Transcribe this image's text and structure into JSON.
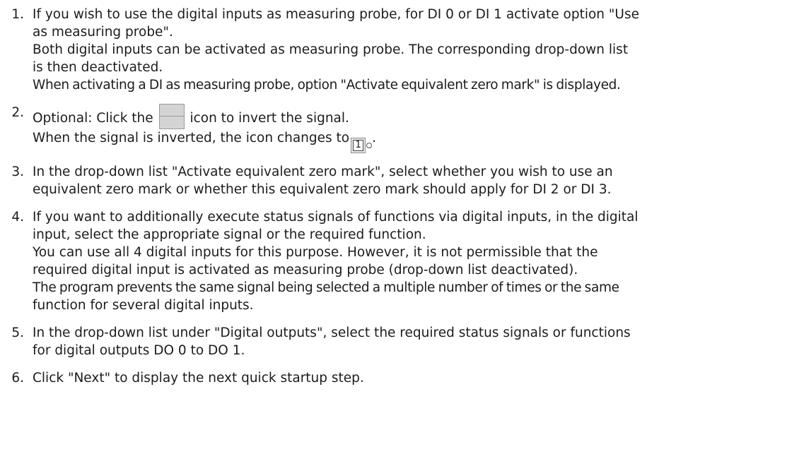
{
  "steps": [
    {
      "num": "1.",
      "lines": [
        "If you wish to use the digital inputs as measuring probe, for DI 0 or DI 1 activate option \"Use",
        "as measuring probe\".",
        "Both digital inputs can be activated as measuring probe. The corresponding drop-down list",
        "is then deactivated.",
        "When activating a DI as measuring probe, option \"Activate equivalent zero mark\" is displayed."
      ]
    },
    {
      "num": "2.",
      "line1_pre": "Optional: Click the",
      "line1_post": "icon to invert the signal.",
      "line2_pre": "When the signal is inverted, the icon changes to",
      "line2_post": ".",
      "icon_inverted_label": "1"
    },
    {
      "num": "3.",
      "lines": [
        "In the drop-down list \"Activate equivalent zero mark\", select whether you wish to use an",
        "equivalent zero mark or whether this equivalent zero mark should apply for DI 2 or DI 3."
      ]
    },
    {
      "num": "4.",
      "lines": [
        "If you want to additionally execute status signals of functions via digital inputs, in the digital",
        "input, select the appropriate signal or the required function.",
        "You can use all 4 digital inputs for this purpose. However, it is not permissible that the",
        "required digital input is activated as measuring probe (drop-down list deactivated).",
        "The program prevents the same signal being selected a multiple number of times or the same",
        "function for several digital inputs."
      ]
    },
    {
      "num": "5.",
      "lines": [
        "In the drop-down list under \"Digital outputs\", select the required status signals or functions",
        "for digital outputs DO 0 to DO 1."
      ]
    },
    {
      "num": "6.",
      "lines": [
        "Click \"Next\" to display the next quick startup step."
      ]
    }
  ]
}
